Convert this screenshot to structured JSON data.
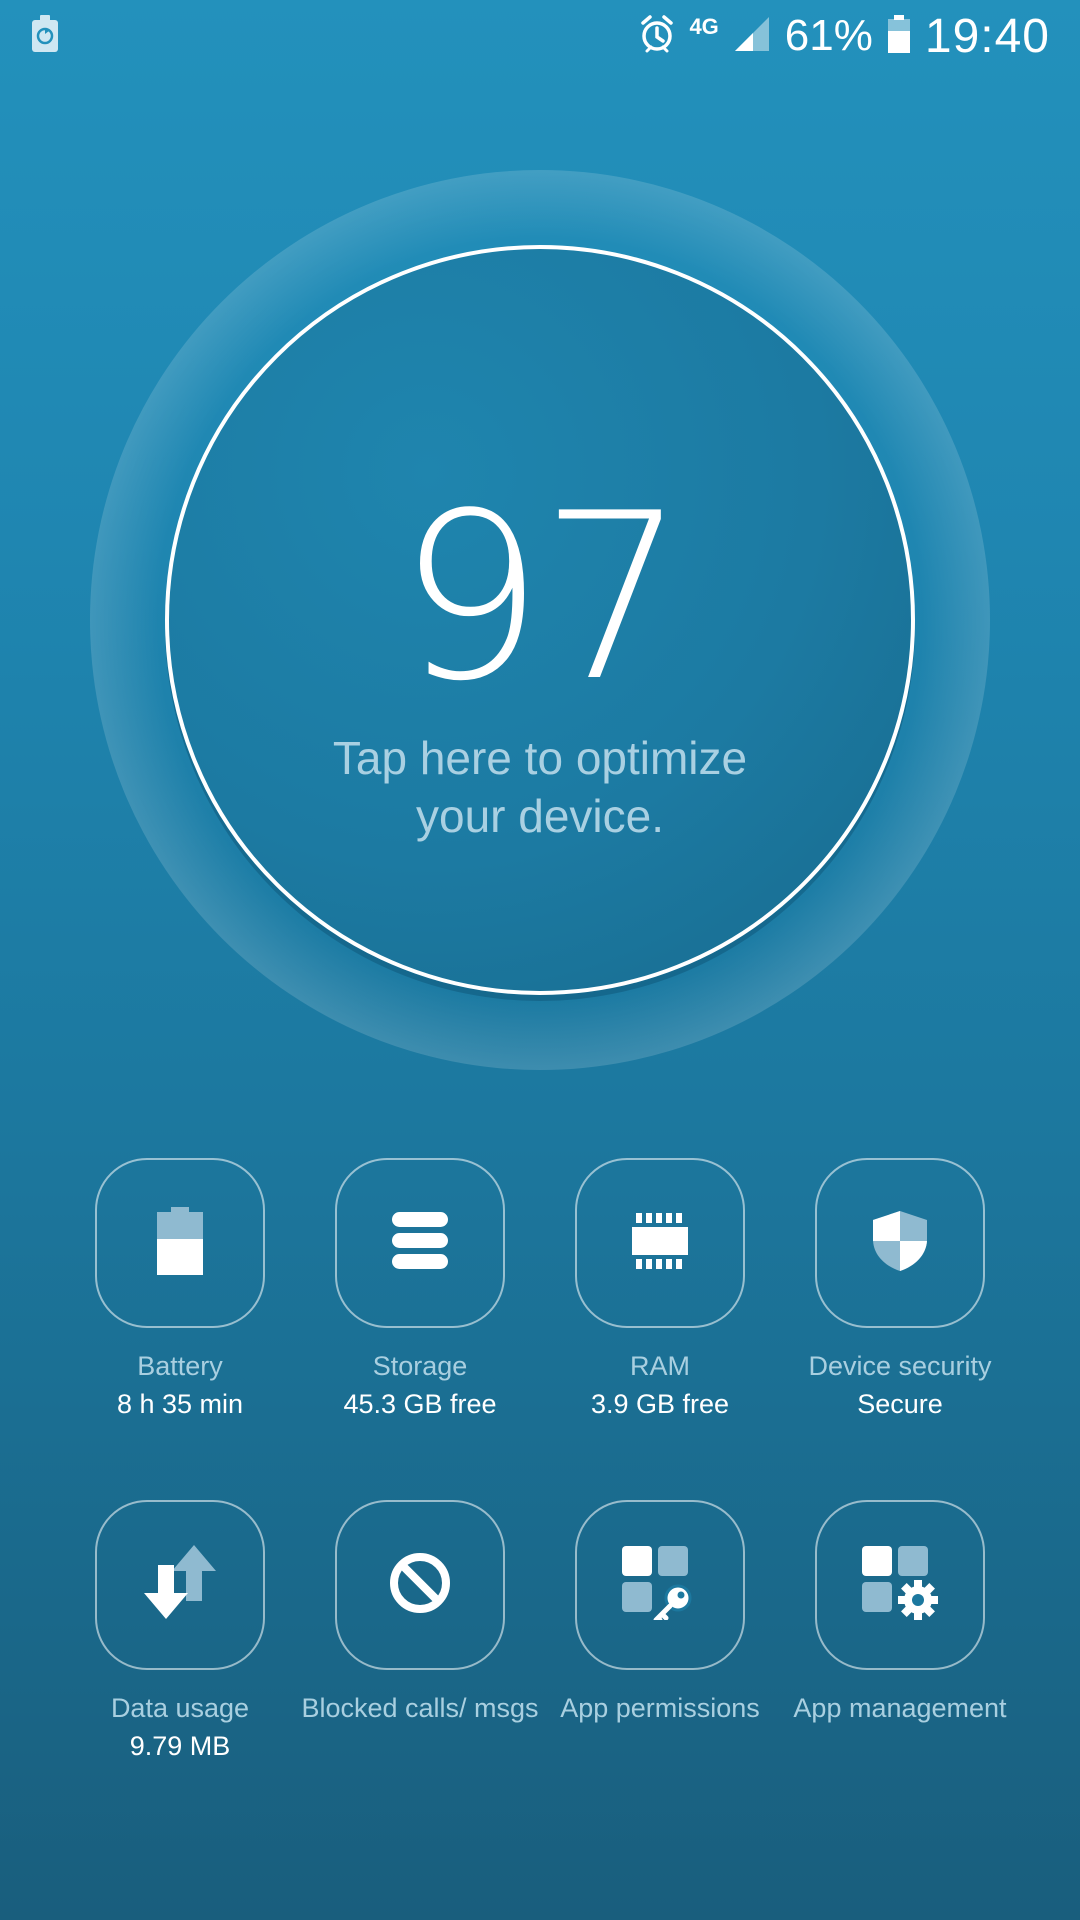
{
  "status_bar": {
    "battery_percent": "61%",
    "time": "19:40",
    "network_type": "4G",
    "icons": [
      "battery-saver-icon",
      "alarm-icon",
      "signal-icon",
      "battery-icon"
    ]
  },
  "score": {
    "value": "97",
    "hint": "Tap here to optimize your device."
  },
  "tiles": [
    {
      "label": "Battery",
      "value": "8 h 35 min",
      "icon": "battery-icon"
    },
    {
      "label": "Storage",
      "value": "45.3 GB free",
      "icon": "storage-icon"
    },
    {
      "label": "RAM",
      "value": "3.9 GB free",
      "icon": "ram-chip-icon"
    },
    {
      "label": "Device security",
      "value": "Secure",
      "icon": "shield-icon"
    },
    {
      "label": "Data usage",
      "value": "9.79 MB",
      "icon": "data-transfer-icon"
    },
    {
      "label": "Blocked calls/ msgs",
      "value": "",
      "icon": "block-icon"
    },
    {
      "label": "App permissions",
      "value": "",
      "icon": "app-permissions-key-icon"
    },
    {
      "label": "App management",
      "value": "",
      "icon": "app-management-gear-icon"
    }
  ],
  "colors": {
    "background_top": "#2391bc",
    "background_bottom": "#195e7d",
    "label_color": "#a9cfe0"
  }
}
